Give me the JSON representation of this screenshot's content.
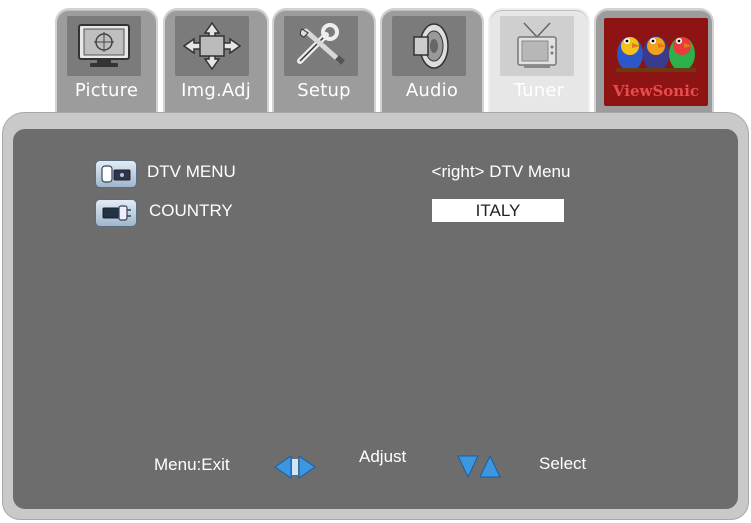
{
  "tabs": [
    {
      "label": "Picture",
      "icon": "monitor-icon"
    },
    {
      "label": "Img.Adj",
      "icon": "move-arrows-icon"
    },
    {
      "label": "Setup",
      "icon": "tools-icon"
    },
    {
      "label": "Audio",
      "icon": "speaker-icon"
    },
    {
      "label": "Tuner",
      "icon": "tv-antenna-icon",
      "active": true
    },
    {
      "label": "ViewSonic",
      "icon": "viewsonic-birds-logo"
    }
  ],
  "menu": {
    "rows": [
      {
        "label": "DTV MENU",
        "value": "<right> DTV Menu",
        "icon": "tv-remote-icon"
      },
      {
        "label": "COUNTRY",
        "value": "ITALY",
        "icon": "tv-plug-icon"
      }
    ]
  },
  "footer": {
    "exit": "Menu:Exit",
    "adjust": "Adjust",
    "select": "Select"
  },
  "colors": {
    "panel": "#6d6d6d",
    "tab": "#9c9c9c",
    "active_tab": "#e7e7e7",
    "arrow_blue": "#2f8ad8",
    "brand_red": "#8e1414"
  }
}
